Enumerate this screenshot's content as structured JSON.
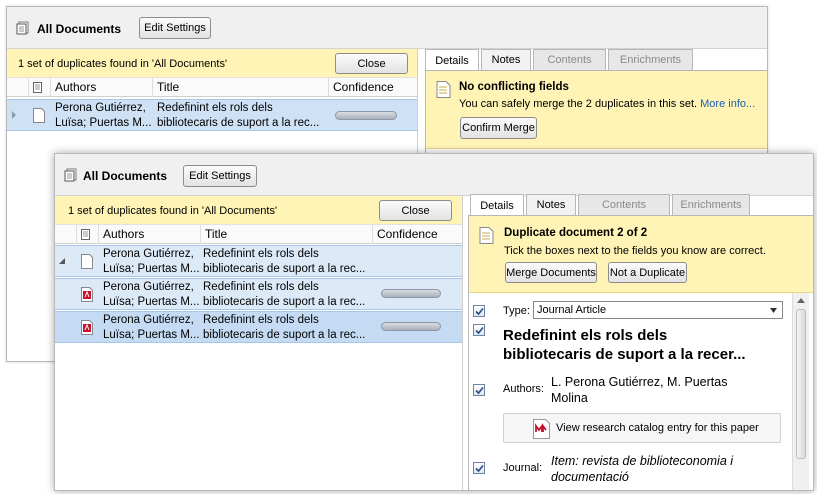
{
  "back": {
    "title": "All Documents",
    "edit_settings": "Edit Settings",
    "dup_message": "1 set of duplicates found in 'All Documents'",
    "close": "Close",
    "columns": {
      "authors": "Authors",
      "title": "Title",
      "confidence": "Confidence"
    },
    "row": {
      "authors1": "Perona Gutiérrez,",
      "authors2": "Luïsa; Puertas M...",
      "title1": "Redefinint els rols dels",
      "title2": "bibliotecaris de suport a la rec..."
    },
    "tabs": [
      "Details",
      "Notes",
      "Contents",
      "Enrichments"
    ],
    "panel": {
      "heading": "No conflicting fields",
      "text": "You can safely merge the 2 duplicates in this set.",
      "link": "More info...",
      "confirm": "Confirm Merge"
    }
  },
  "front": {
    "title": "All Documents",
    "edit_settings": "Edit Settings",
    "dup_message": "1 set of duplicates found in 'All Documents'",
    "close": "Close",
    "columns": {
      "authors": "Authors",
      "title": "Title",
      "confidence": "Confidence"
    },
    "rows": [
      {
        "authors1": "Perona Gutiérrez,",
        "authors2": "Luïsa; Puertas M...",
        "title1": "Redefinint els rols dels",
        "title2": "bibliotecaris de suport a la rec...",
        "icon": "document-icon"
      },
      {
        "authors1": "Perona Gutiérrez,",
        "authors2": "Luïsa; Puertas M...",
        "title1": "Redefinint els rols dels",
        "title2": "bibliotecaris de suport a la rec...",
        "icon": "pdf-icon"
      },
      {
        "authors1": "Perona Gutiérrez,",
        "authors2": "Luïsa; Puertas M...",
        "title1": "Redefinint els rols dels",
        "title2": "bibliotecaris de suport a la rec...",
        "icon": "pdf-icon"
      }
    ],
    "tabs": [
      "Details",
      "Notes",
      "Contents",
      "Enrichments"
    ],
    "panel": {
      "heading": "Duplicate document 2 of 2",
      "text": "Tick the boxes next to the fields you know are correct.",
      "merge": "Merge Documents",
      "not_dup": "Not a Duplicate",
      "type_label": "Type:",
      "type_value": "Journal Article",
      "doc_title1": "Redefinint els rols dels",
      "doc_title2": "bibliotecaris de suport a la recer...",
      "authors_label": "Authors:",
      "authors1": "L. Perona Gutiérrez, M. Puertas",
      "authors2": "Molina",
      "catalog": "View research catalog entry for this paper",
      "journal_label": "Journal:",
      "journal1": "Item: revista de biblioteconomia i",
      "journal2": "documentació"
    }
  },
  "colors": {
    "yellow": "#fff4b5",
    "selection": "#cfe2f5",
    "link": "#1a5fb4"
  }
}
